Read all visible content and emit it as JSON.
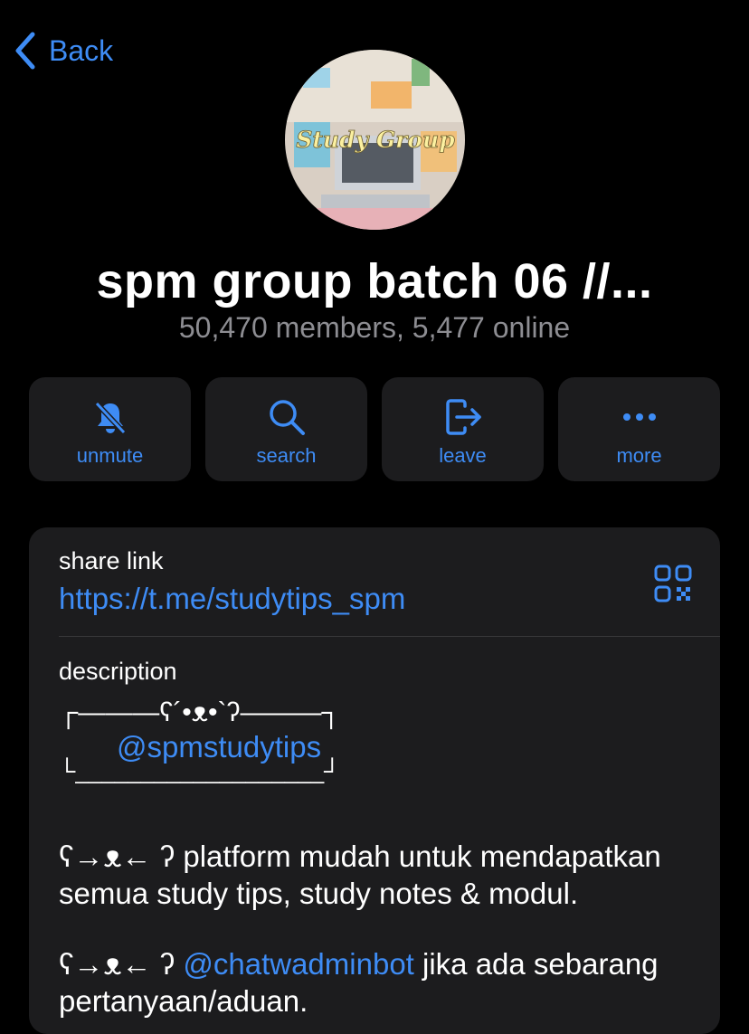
{
  "nav": {
    "back_label": "Back"
  },
  "group": {
    "avatar_text": "Study Group",
    "title": "spm group batch 06 //...",
    "subtitle": "50,470 members, 5,477 online"
  },
  "actions": [
    {
      "label": "unmute",
      "icon": "bell-slash-icon"
    },
    {
      "label": "search",
      "icon": "search-icon"
    },
    {
      "label": "leave",
      "icon": "leave-icon"
    },
    {
      "label": "more",
      "icon": "more-icon"
    }
  ],
  "info": {
    "share_label": "share link",
    "share_link": "https://t.me/studytips_spm",
    "description_label": "description",
    "desc_frame_top": "┌———ʕ´•ᴥ•`ʔ———┐",
    "desc_handle": "@spmstudytips",
    "desc_frame_bottom": "└___________________┘",
    "para1": "ʕ→ᴥ← ʔ platform mudah untuk mendapatkan semua study tips, study notes & modul.",
    "para2_prefix": "ʕ→ᴥ← ʔ ",
    "para2_link": "@chatwadminbot",
    "para2_suffix": " jika ada sebarang pertanyaan/aduan."
  },
  "colors": {
    "accent": "#3e8cf5",
    "card": "#1c1c1e",
    "muted": "#8d8d92"
  }
}
